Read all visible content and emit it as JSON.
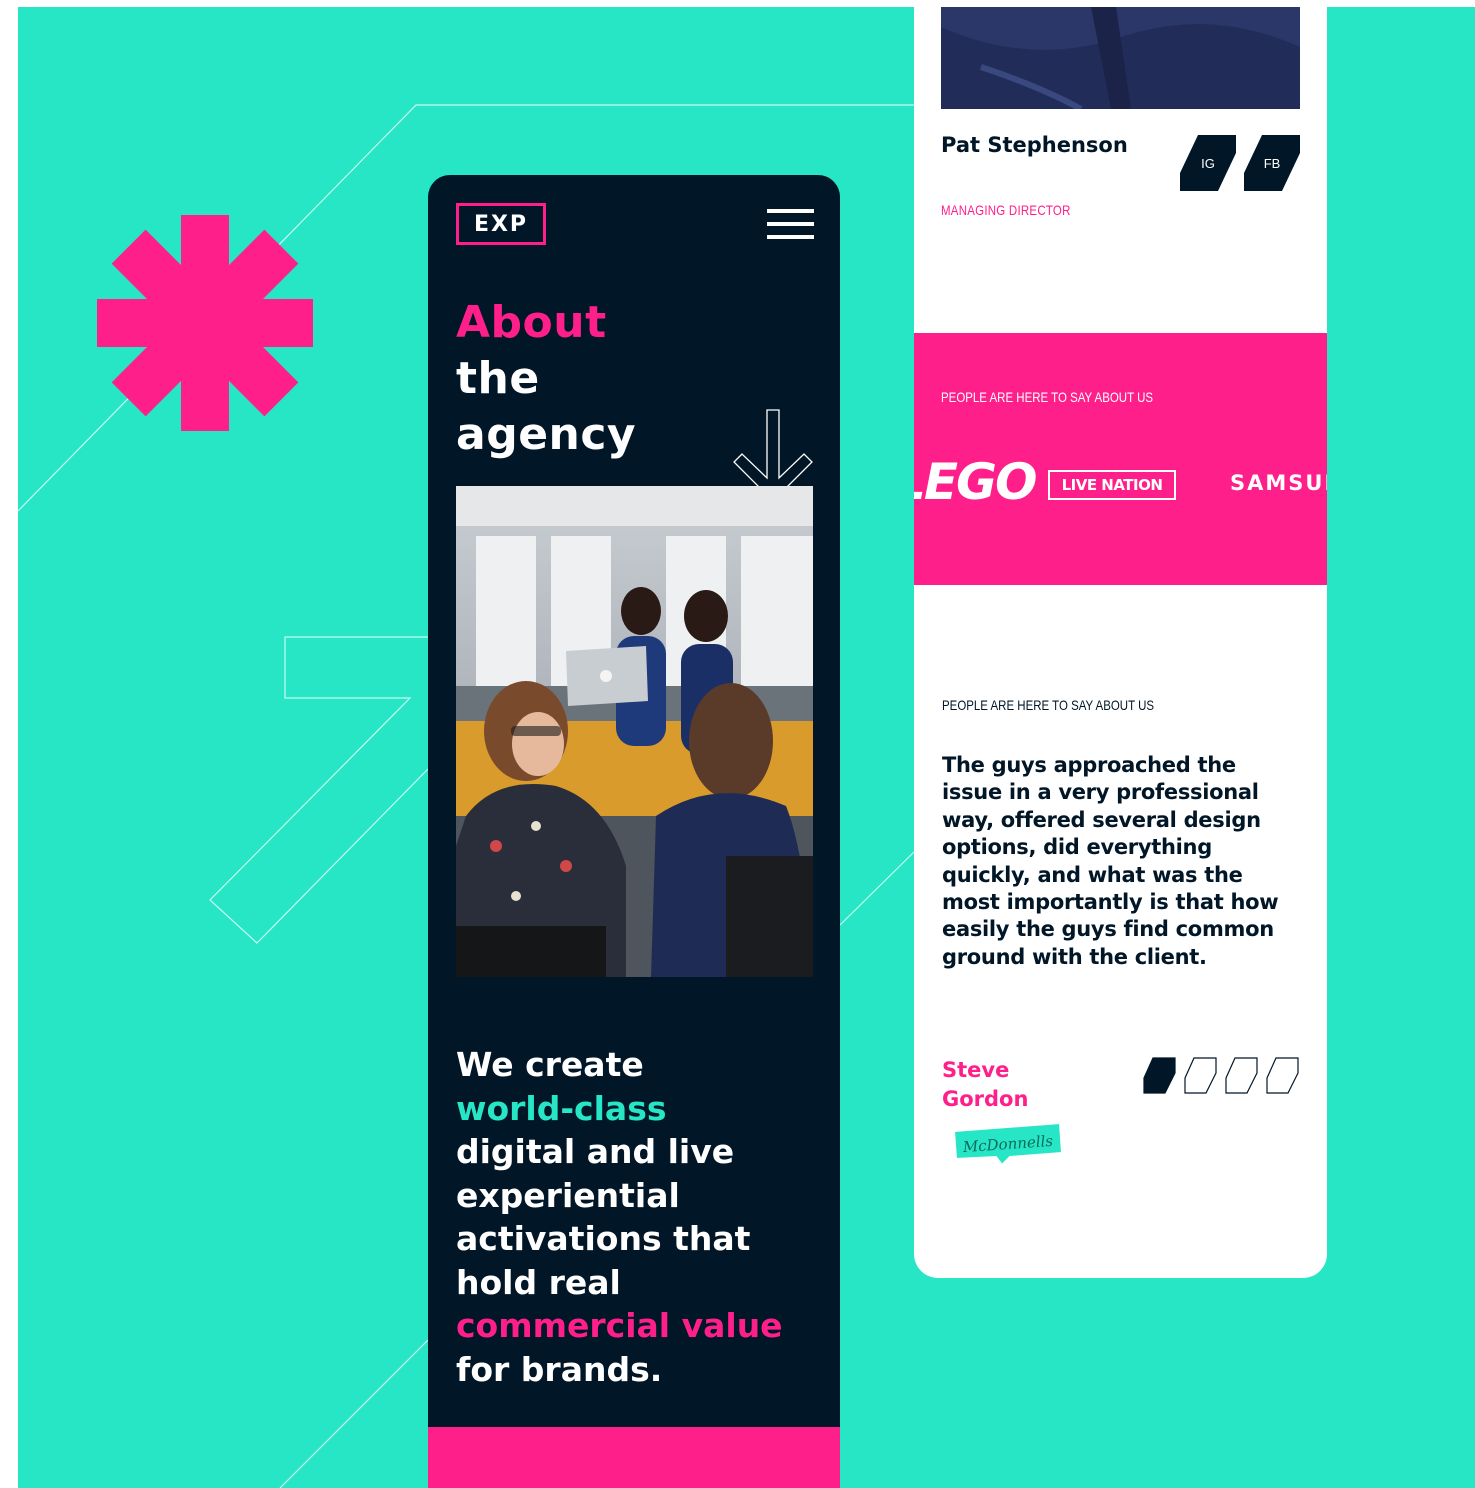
{
  "colors": {
    "teal": "#27e6c6",
    "pink": "#ff1f8a",
    "navy": "#011627",
    "white": "#ffffff"
  },
  "mobile_about": {
    "logo_text": "EXP",
    "menu_icon": "hamburger-menu-icon",
    "heading": {
      "line1": "About",
      "line2": "the",
      "line3": "agency"
    },
    "scroll_icon": "arrow-down-icon",
    "photo_alt": "Team of colleagues talking around a laptop in an office",
    "mission": {
      "part1": "We create",
      "highlight1": "world-class",
      "part2": "digital and live experiential activations that hold real",
      "highlight2": "commercial value",
      "part3": "for brands."
    }
  },
  "mobile_team": {
    "member": {
      "name": "Pat Stephenson",
      "role": "MANAGING DIRECTOR",
      "social": [
        {
          "label": "IG"
        },
        {
          "label": "FB"
        }
      ]
    },
    "clients": {
      "label": "PEOPLE ARE HERE TO SAY ABOUT US",
      "logos": [
        "LEGO",
        "LIVE NATION",
        "SAMSUNG"
      ]
    },
    "testimonial": {
      "label": "PEOPLE ARE HERE TO SAY ABOUT US",
      "quote": "The guys approached the issue in a very professional way, offered several design options, did everything quickly, and what was the most importantly is that how easily the guys find common ground with the client.",
      "author": "Steve Gordon",
      "company": "McDonnells",
      "pager": {
        "total": 4,
        "active": 1
      }
    }
  }
}
